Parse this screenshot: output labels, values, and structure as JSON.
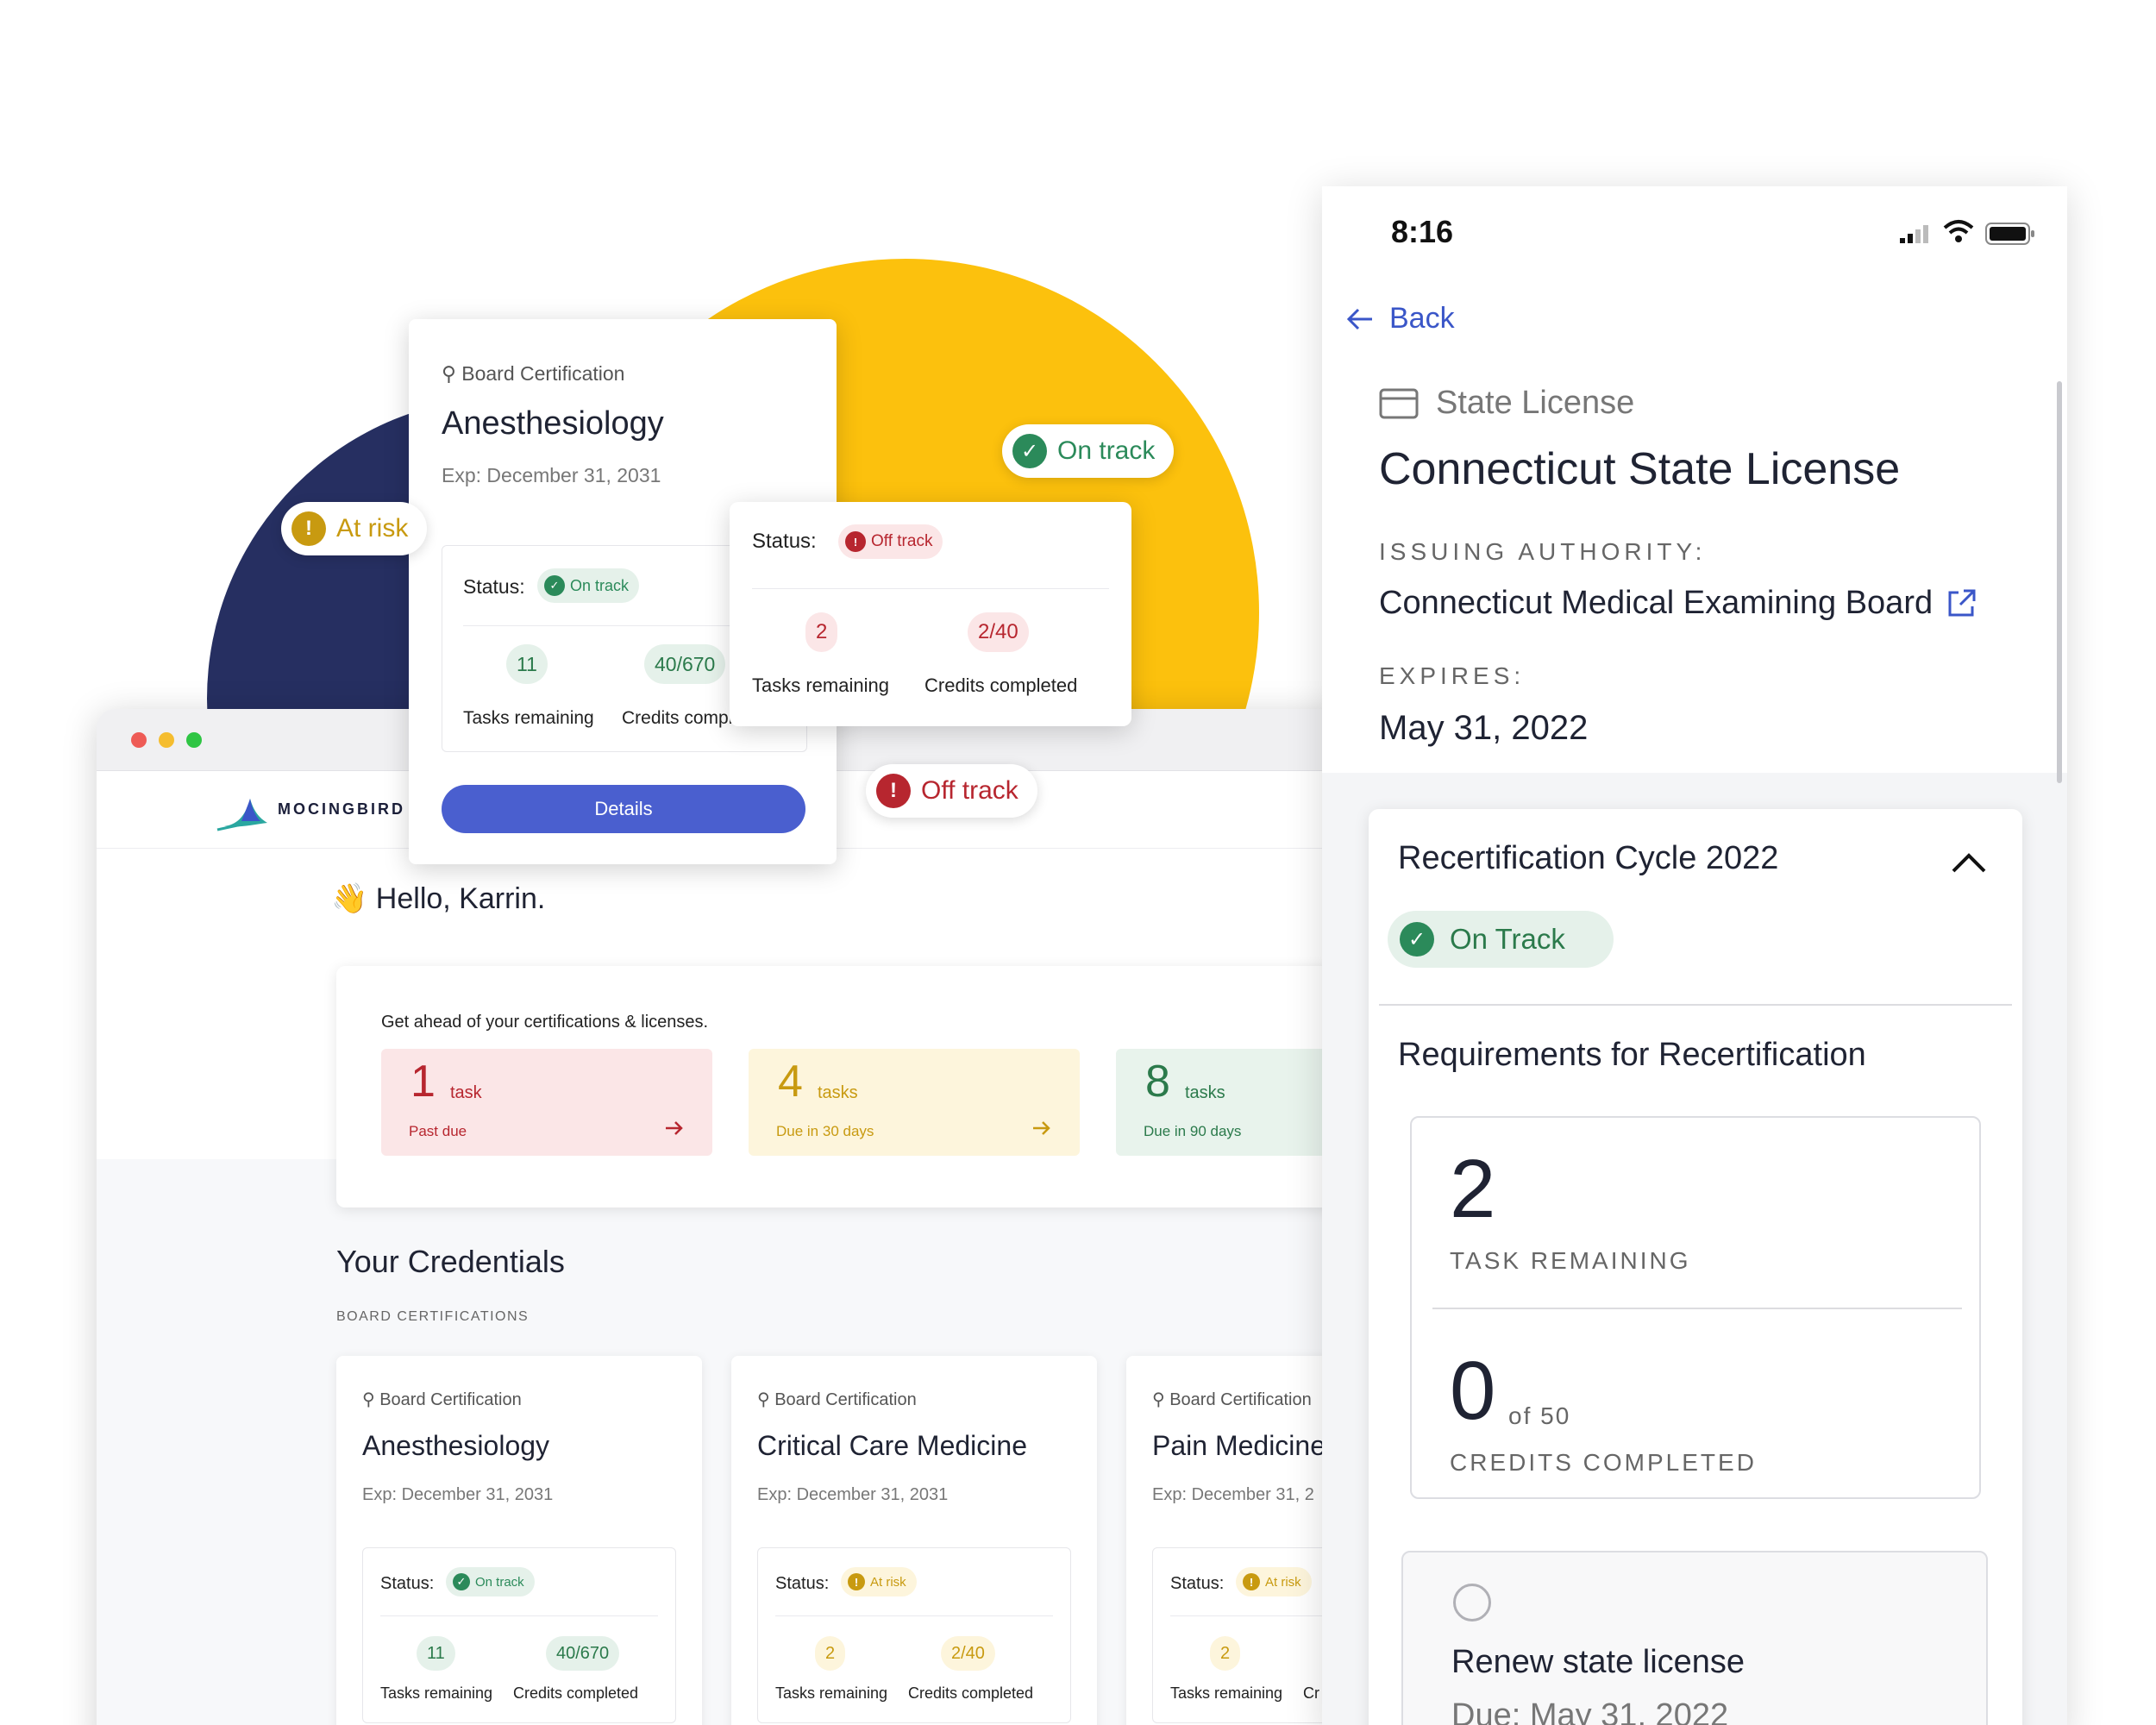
{
  "colors": {
    "yellow": "#fcc10d",
    "navy": "#262f61",
    "on_track": "#2b8a5a",
    "at_risk": "#c89a10",
    "off_track": "#b7262f",
    "primary": "#4a5fcf"
  },
  "icons": [
    "award-icon",
    "check-circle-icon",
    "alert-icon",
    "arrow-right-icon",
    "back-arrow-icon",
    "card-icon",
    "external-link-icon",
    "chevron-up-icon",
    "wave-emoji",
    "radio-icon"
  ],
  "badges": {
    "on_track": "On track",
    "at_risk": "At risk",
    "off_track": "Off track"
  },
  "popup_card": {
    "type": "Board Certification",
    "name": "Anesthesiology",
    "exp": "Exp: December 31, 2031",
    "status_label": "Status:",
    "status": "On track",
    "tasks": "11",
    "tasks_label": "Tasks remaining",
    "credits": "40/670",
    "credits_label": "Credits compl",
    "button": "Details"
  },
  "off_card": {
    "status_label": "Status:",
    "status": "Off track",
    "tasks": "2",
    "tasks_label": "Tasks remaining",
    "credits": "2/40",
    "credits_label": "Credits completed"
  },
  "app": {
    "logo": "MOCINGBIRD",
    "greeting_emoji": "👋",
    "greeting": "Hello, Karrin.",
    "summary": {
      "prompt": "Get ahead of your certifications & licenses.",
      "tiles": [
        {
          "num": "1",
          "unit": "task",
          "sub": "Past due"
        },
        {
          "num": "4",
          "unit": "tasks",
          "sub": "Due in 30 days"
        },
        {
          "num": "8",
          "unit": "tasks",
          "sub": "Due in 90 days"
        }
      ]
    },
    "section_title": "Your Credentials",
    "section_sub": "BOARD CERTIFICATIONS",
    "credentials": [
      {
        "type": "Board Certification",
        "name": "Anesthesiology",
        "exp": "Exp: December 31, 2031",
        "status_label": "Status:",
        "status": "On track",
        "tasks": "11",
        "tasks_label": "Tasks remaining",
        "credits": "40/670",
        "credits_label": "Credits completed"
      },
      {
        "type": "Board Certification",
        "name": "Critical Care Medicine",
        "exp": "Exp: December 31, 2031",
        "status_label": "Status:",
        "status": "At risk",
        "tasks": "2",
        "tasks_label": "Tasks remaining",
        "credits": "2/40",
        "credits_label": "Credits completed"
      },
      {
        "type": "Board Certification",
        "name": "Pain Medicine",
        "exp": "Exp: December 31, 2",
        "status_label": "Status:",
        "status": "At risk",
        "tasks": "2",
        "tasks_label": "Tasks remaining",
        "credits": "Cr",
        "credits_label": ""
      }
    ]
  },
  "phone": {
    "time": "8:16",
    "back": "Back",
    "license_type": "State License",
    "license_name": "Connecticut State License",
    "issuing_label": "ISSUING AUTHORITY:",
    "issuing_value": "Connecticut Medical Examining Board",
    "expires_label": "EXPIRES:",
    "expires_value": "May 31, 2022",
    "cycle_title": "Recertification Cycle 2022",
    "cycle_status": "On Track",
    "requirements_title": "Requirements for Recertification",
    "tasks_num": "2",
    "tasks_label": "TASK REMAINING",
    "credits_num": "0",
    "credits_of": "of 50",
    "credits_label": "CREDITS COMPLETED",
    "renew_title": "Renew state license",
    "renew_due": "Due: May 31, 2022"
  }
}
